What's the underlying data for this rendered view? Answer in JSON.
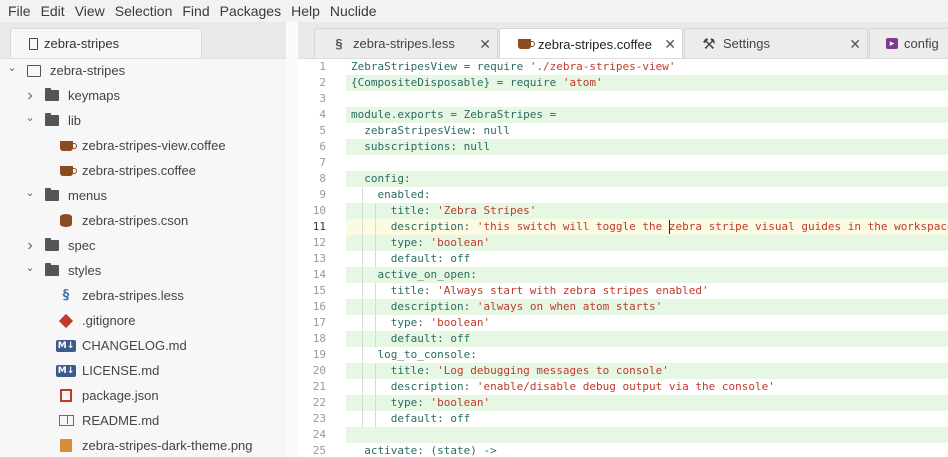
{
  "menu": [
    "File",
    "Edit",
    "View",
    "Selection",
    "Find",
    "Packages",
    "Help",
    "Nuclide"
  ],
  "tree": {
    "tab_label": "zebra-stripes",
    "items": [
      {
        "label": "zebra-stripes",
        "type": "repo",
        "depth": 0,
        "expanded": true
      },
      {
        "label": "keymaps",
        "type": "folder",
        "depth": 1,
        "expanded": false
      },
      {
        "label": "lib",
        "type": "folder",
        "depth": 1,
        "expanded": true
      },
      {
        "label": "zebra-stripes-view.coffee",
        "type": "coffee",
        "depth": 2
      },
      {
        "label": "zebra-stripes.coffee",
        "type": "coffee",
        "depth": 2
      },
      {
        "label": "menus",
        "type": "folder",
        "depth": 1,
        "expanded": true
      },
      {
        "label": "zebra-stripes.cson",
        "type": "cson",
        "depth": 2
      },
      {
        "label": "spec",
        "type": "folder",
        "depth": 1,
        "expanded": false
      },
      {
        "label": "styles",
        "type": "folder",
        "depth": 1,
        "expanded": true
      },
      {
        "label": "zebra-stripes.less",
        "type": "css",
        "depth": 2
      },
      {
        "label": ".gitignore",
        "type": "git",
        "depth": 1
      },
      {
        "label": "CHANGELOG.md",
        "type": "md",
        "depth": 1
      },
      {
        "label": "LICENSE.md",
        "type": "md",
        "depth": 1
      },
      {
        "label": "package.json",
        "type": "pkg",
        "depth": 1
      },
      {
        "label": "README.md",
        "type": "readme",
        "depth": 1
      },
      {
        "label": "zebra-stripes-dark-theme.png",
        "type": "png",
        "depth": 1
      }
    ]
  },
  "tabs": [
    {
      "label": "zebra-stripes.less",
      "icon": "css-icon",
      "active": false
    },
    {
      "label": "zebra-stripes.coffee",
      "icon": "coffee-icon",
      "active": true
    },
    {
      "label": "Settings",
      "icon": "tools-icon",
      "active": false
    },
    {
      "label": "config",
      "icon": "terminal-icon",
      "active": false
    }
  ],
  "editor": {
    "cursor_line": 11,
    "lines": [
      {
        "n": "1",
        "text": "ZebraStripesView = require './zebra-stripes-view'"
      },
      {
        "n": "2",
        "text": "{CompositeDisposable} = require 'atom'"
      },
      {
        "n": "3",
        "text": ""
      },
      {
        "n": "4",
        "text": "module.exports = ZebraStripes ="
      },
      {
        "n": "5",
        "text": "  zebraStripesView: null"
      },
      {
        "n": "6",
        "text": "  subscriptions: null"
      },
      {
        "n": "7",
        "text": ""
      },
      {
        "n": "8",
        "text": "  config:"
      },
      {
        "n": "9",
        "text": "    enabled:"
      },
      {
        "n": "10",
        "text": "      title: 'Zebra Stripes'"
      },
      {
        "n": "11",
        "text": "      description: 'this switch will toggle the zebra stripe visual guides in the workspace'"
      },
      {
        "n": "12",
        "text": "      type: 'boolean'"
      },
      {
        "n": "13",
        "text": "      default: off"
      },
      {
        "n": "14",
        "text": "    active_on_open:"
      },
      {
        "n": "15",
        "text": "      title: 'Always start with zebra stripes enabled'"
      },
      {
        "n": "16",
        "text": "      description: 'always on when atom starts'"
      },
      {
        "n": "17",
        "text": "      type: 'boolean'"
      },
      {
        "n": "18",
        "text": "      default: off"
      },
      {
        "n": "19",
        "text": "    log_to_console:"
      },
      {
        "n": "20",
        "text": "      title: 'Log debugging messages to console'"
      },
      {
        "n": "21",
        "text": "      description: 'enable/disable debug output via the console'"
      },
      {
        "n": "22",
        "text": "      type: 'boolean'"
      },
      {
        "n": "23",
        "text": "      default: off"
      },
      {
        "n": "24",
        "text": ""
      },
      {
        "n": "25",
        "text": "  activate: (state) ->"
      }
    ]
  },
  "colors": {
    "zebra_stripe": "#e6f7e4",
    "cursor_line": "#fbfbe4",
    "string": "#c0392b",
    "identifier": "#2b6b5f"
  }
}
